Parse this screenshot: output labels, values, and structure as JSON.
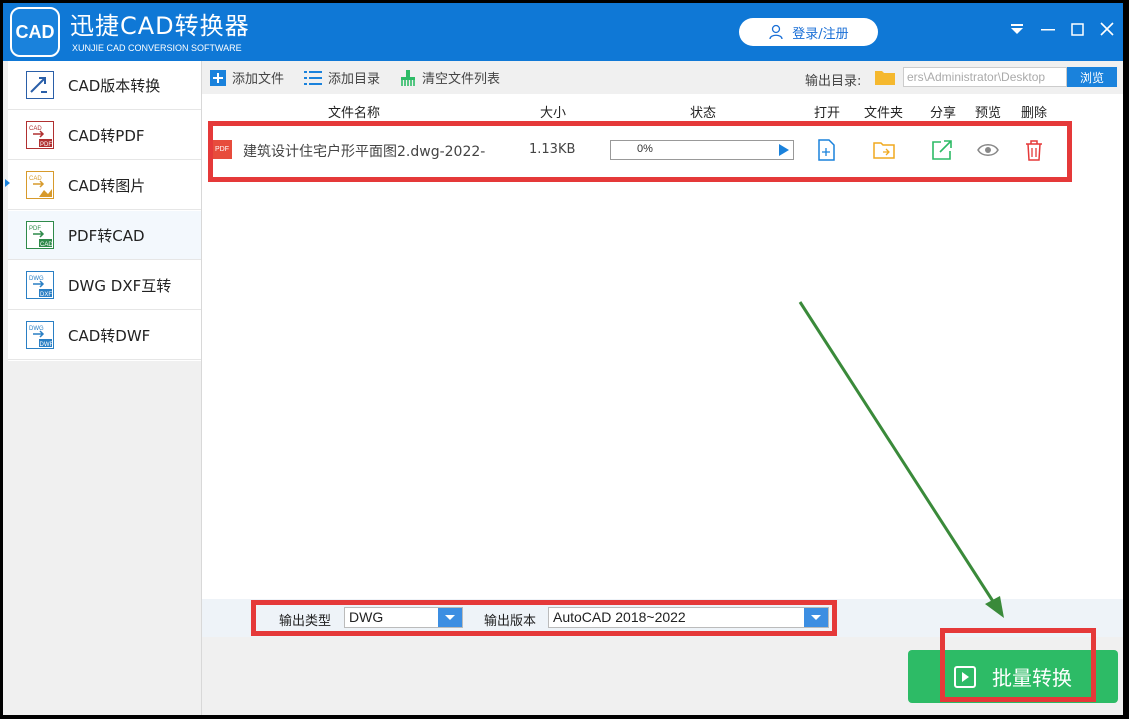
{
  "app": {
    "logo_text": "CAD",
    "title": "迅捷CAD转换器",
    "subtitle": "XUNJIE CAD CONVERSION SOFTWARE",
    "login_label": "登录/注册"
  },
  "sidebar": {
    "items": [
      {
        "label": "CAD版本转换",
        "icon": "version-convert-icon"
      },
      {
        "label": "CAD转PDF",
        "icon": "cad-to-pdf-icon"
      },
      {
        "label": "CAD转图片",
        "icon": "cad-to-image-icon"
      },
      {
        "label": "PDF转CAD",
        "icon": "pdf-to-cad-icon",
        "active": true
      },
      {
        "label": "DWG DXF互转",
        "icon": "dwg-dxf-icon"
      },
      {
        "label": "CAD转DWF",
        "icon": "cad-to-dwf-icon"
      }
    ]
  },
  "toolbar": {
    "add_file": "添加文件",
    "add_dir": "添加目录",
    "clear_list": "清空文件列表",
    "output_dir_label": "输出目录:",
    "output_dir_value": "ers\\Administrator\\Desktop",
    "browse": "浏览"
  },
  "columns": {
    "name": "文件名称",
    "size": "大小",
    "status": "状态",
    "open": "打开",
    "folder": "文件夹",
    "share": "分享",
    "preview": "预览",
    "delete": "删除"
  },
  "files": [
    {
      "badge": "PDF",
      "name": "建筑设计住宅户形平面图2.dwg-2022-",
      "size": "1.13KB",
      "progress": "0%"
    }
  ],
  "options": {
    "output_type_label": "输出类型",
    "output_type_value": "DWG",
    "output_version_label": "输出版本",
    "output_version_value": "AutoCAD 2018~2022"
  },
  "convert_button": "批量转换",
  "colors": {
    "titlebar": "#0f78d6",
    "accent": "#1a82dc",
    "convert": "#2dbb66",
    "highlight": "#e53939",
    "arrow": "#3a8a3a"
  }
}
